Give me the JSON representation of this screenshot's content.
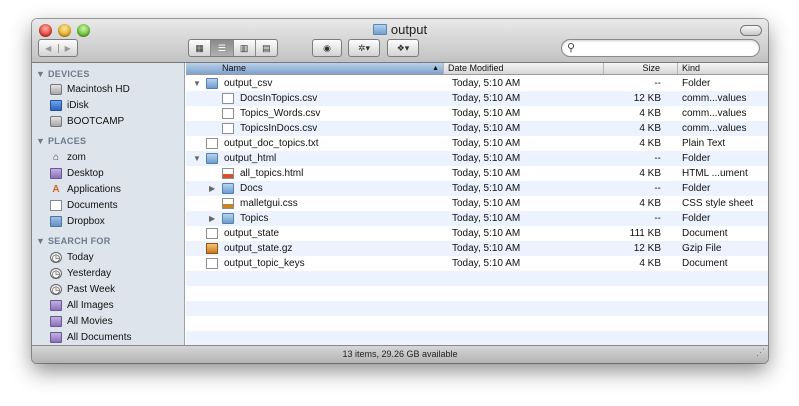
{
  "window": {
    "title": "output",
    "status": "13 items, 29.26 GB available"
  },
  "toolbar": {
    "back_icon": "◀",
    "forward_icon": "▶",
    "view_icons": [
      "▦",
      "☰",
      "▥",
      "▤"
    ],
    "eye_icon": "◉",
    "gear_label": "✲▾",
    "dropbox_label": "❖▾",
    "search_icon": "⚲",
    "search_value": ""
  },
  "sidebar": {
    "devices_header": "▼ DEVICES",
    "places_header": "▼ PLACES",
    "search_header": "▼ SEARCH FOR",
    "devices": [
      {
        "label": "Macintosh HD",
        "icon": "drive-icon"
      },
      {
        "label": "iDisk",
        "icon": "idisk-icon"
      },
      {
        "label": "BOOTCAMP",
        "icon": "drive-icon"
      }
    ],
    "places": [
      {
        "label": "zom",
        "icon": "home-icon"
      },
      {
        "label": "Desktop",
        "icon": "desktop-icon"
      },
      {
        "label": "Applications",
        "icon": "applications-icon"
      },
      {
        "label": "Documents",
        "icon": "document-icon"
      },
      {
        "label": "Dropbox",
        "icon": "folder-icon"
      }
    ],
    "searches": [
      {
        "label": "Today",
        "icon": "clock-icon"
      },
      {
        "label": "Yesterday",
        "icon": "clock-icon"
      },
      {
        "label": "Past Week",
        "icon": "clock-icon"
      },
      {
        "label": "All Images",
        "icon": "smart-folder-icon"
      },
      {
        "label": "All Movies",
        "icon": "smart-folder-icon"
      },
      {
        "label": "All Documents",
        "icon": "smart-folder-icon"
      }
    ]
  },
  "columns": {
    "name": "Name",
    "date": "Date Modified",
    "size": "Size",
    "kind": "Kind",
    "sort_icon": "▲"
  },
  "files": [
    {
      "name": "output_csv",
      "date": "Today, 5:10 AM",
      "size": "--",
      "kind": "Folder",
      "type": "folder",
      "level": 0,
      "toggle": "▼"
    },
    {
      "name": "DocsInTopics.csv",
      "date": "Today, 5:10 AM",
      "size": "12 KB",
      "kind": "comm...values",
      "type": "doc",
      "level": 1,
      "toggle": ""
    },
    {
      "name": "Topics_Words.csv",
      "date": "Today, 5:10 AM",
      "size": "4 KB",
      "kind": "comm...values",
      "type": "doc",
      "level": 1,
      "toggle": ""
    },
    {
      "name": "TopicsInDocs.csv",
      "date": "Today, 5:10 AM",
      "size": "4 KB",
      "kind": "comm...values",
      "type": "doc",
      "level": 1,
      "toggle": ""
    },
    {
      "name": "output_doc_topics.txt",
      "date": "Today, 5:10 AM",
      "size": "4 KB",
      "kind": "Plain Text",
      "type": "doc",
      "level": 0,
      "toggle": ""
    },
    {
      "name": "output_html",
      "date": "Today, 5:10 AM",
      "size": "--",
      "kind": "Folder",
      "type": "folder",
      "level": 0,
      "toggle": "▼"
    },
    {
      "name": "all_topics.html",
      "date": "Today, 5:10 AM",
      "size": "4 KB",
      "kind": "HTML ...ument",
      "type": "html",
      "level": 1,
      "toggle": ""
    },
    {
      "name": "Docs",
      "date": "Today, 5:10 AM",
      "size": "--",
      "kind": "Folder",
      "type": "folder",
      "level": 1,
      "toggle": "▶"
    },
    {
      "name": "malletgui.css",
      "date": "Today, 5:10 AM",
      "size": "4 KB",
      "kind": "CSS style sheet",
      "type": "css",
      "level": 1,
      "toggle": ""
    },
    {
      "name": "Topics",
      "date": "Today, 5:10 AM",
      "size": "--",
      "kind": "Folder",
      "type": "folder",
      "level": 1,
      "toggle": "▶"
    },
    {
      "name": "output_state",
      "date": "Today, 5:10 AM",
      "size": "111 KB",
      "kind": "Document",
      "type": "doc",
      "level": 0,
      "toggle": ""
    },
    {
      "name": "output_state.gz",
      "date": "Today, 5:10 AM",
      "size": "12 KB",
      "kind": "Gzip File",
      "type": "gz",
      "level": 0,
      "toggle": ""
    },
    {
      "name": "output_topic_keys",
      "date": "Today, 5:10 AM",
      "size": "4 KB",
      "kind": "Document",
      "type": "doc",
      "level": 0,
      "toggle": ""
    }
  ]
}
